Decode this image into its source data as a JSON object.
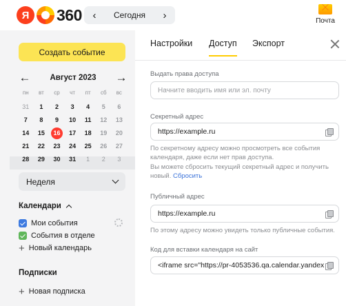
{
  "header": {
    "logo": "Я 360",
    "logo_ya": "Я",
    "logo_num": "360",
    "date_label": "Сегодня",
    "prev_arrow": "‹",
    "next_arrow": "›",
    "mail_label": "Почта"
  },
  "sidebar": {
    "create_label": "Создать событие",
    "calendar": {
      "month": "Август 2023",
      "prev": "←",
      "next": "→",
      "weekdays": [
        "пн",
        "вт",
        "ср",
        "чт",
        "пт",
        "сб",
        "вс"
      ],
      "weeks": [
        [
          "31",
          "1",
          "2",
          "3",
          "4",
          "5",
          "6"
        ],
        [
          "7",
          "8",
          "9",
          "10",
          "11",
          "12",
          "13"
        ],
        [
          "14",
          "15",
          "16",
          "17",
          "18",
          "19",
          "20"
        ],
        [
          "21",
          "22",
          "23",
          "24",
          "25",
          "26",
          "27"
        ],
        [
          "28",
          "29",
          "30",
          "31",
          "1",
          "2",
          "3"
        ]
      ],
      "today": "16"
    },
    "view_label": "Неделя",
    "calendars_title": "Календари",
    "calendars": [
      {
        "label": "Мои события",
        "color": "#3d7ae0"
      },
      {
        "label": "События в отделе",
        "color": "#5fb65a"
      }
    ],
    "new_calendar": "Новый календарь",
    "subscriptions_title": "Подписки",
    "new_subscription": "Новая подписка"
  },
  "panel": {
    "tabs": [
      "Настройки",
      "Доступ",
      "Экспорт"
    ],
    "active_tab": "Доступ",
    "share": {
      "label": "Выдать права доступа",
      "placeholder": "Начните вводить имя или эл. почту"
    },
    "secret": {
      "label": "Секретный адрес",
      "value": "https://example.ru",
      "hint": "По секретному адресу можно просмотреть все события календаря, даже если нет прав доступа.",
      "reset_hint": "Вы можете сбросить текущий секретный адрес и получить новый.",
      "reset_link": "Сбросить"
    },
    "public": {
      "label": "Публичный адрес",
      "value": "https://example.ru",
      "hint": "По этому адресу можно увидеть только публичные события."
    },
    "embed": {
      "label": "Код для вставки календаря на сайт",
      "value": "<iframe src=\"https://pr-4053536.qa.calendar.yandex"
    }
  },
  "colors": {
    "accent": "#fce454",
    "today": "#ff3b2f",
    "link": "#3a72d9"
  }
}
